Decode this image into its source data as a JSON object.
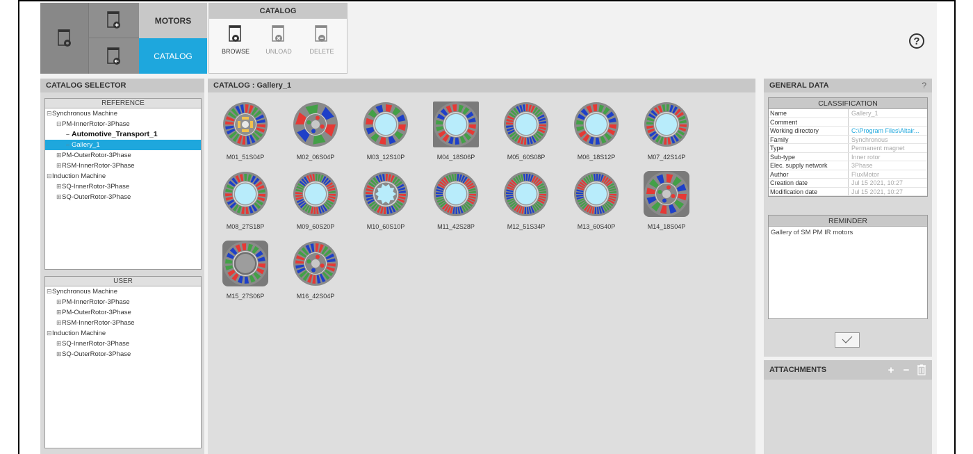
{
  "toolbar": {
    "motors_tab": "MOTORS",
    "catalog_tab": "CATALOG",
    "catalog_group_title": "CATALOG",
    "browse_label": "BROWSE",
    "unload_label": "UNLOAD",
    "delete_label": "DELETE",
    "help_glyph": "?"
  },
  "catalog_selector": {
    "title": "CATALOG SELECTOR",
    "reference": {
      "title": "REFERENCE",
      "nodes": [
        {
          "label": "Synchronous Machine",
          "sign": "⊟",
          "level": 0
        },
        {
          "label": "PM-InnerRotor-3Phase",
          "sign": "⊟",
          "level": 1
        },
        {
          "label": "Automotive_Transport_1",
          "sign": "",
          "level": 2,
          "bold": true
        },
        {
          "label": "Gallery_1",
          "sign": "",
          "level": 2,
          "selected": true
        },
        {
          "label": "PM-OuterRotor-3Phase",
          "sign": "⊞",
          "level": 1
        },
        {
          "label": "RSM-InnerRotor-3Phase",
          "sign": "⊞",
          "level": 1
        },
        {
          "label": "Induction Machine",
          "sign": "⊟",
          "level": 0
        },
        {
          "label": "SQ-InnerRotor-3Phase",
          "sign": "⊞",
          "level": 1
        },
        {
          "label": "SQ-OuterRotor-3Phase",
          "sign": "⊞",
          "level": 1
        }
      ]
    },
    "user": {
      "title": "USER",
      "nodes": [
        {
          "label": "Synchronous Machine",
          "sign": "⊟",
          "level": 0
        },
        {
          "label": "PM-InnerRotor-3Phase",
          "sign": "⊞",
          "level": 1
        },
        {
          "label": "PM-OuterRotor-3Phase",
          "sign": "⊞",
          "level": 1
        },
        {
          "label": "RSM-InnerRotor-3Phase",
          "sign": "⊞",
          "level": 1
        },
        {
          "label": "Induction Machine",
          "sign": "⊟",
          "level": 0
        },
        {
          "label": "SQ-InnerRotor-3Phase",
          "sign": "⊞",
          "level": 1
        },
        {
          "label": "SQ-OuterRotor-3Phase",
          "sign": "⊞",
          "level": 1
        }
      ]
    }
  },
  "catalog": {
    "title": "CATALOG : Gallery_1",
    "motors": [
      {
        "label": "M01_51S04P",
        "slots": 24,
        "rotor": "ipm",
        "square": false
      },
      {
        "label": "M02_06S04P",
        "slots": 6,
        "rotor": "spm",
        "square": false
      },
      {
        "label": "M03_12S10P",
        "slots": 12,
        "rotor": "ring",
        "square": false
      },
      {
        "label": "M04_18S06P",
        "slots": 18,
        "rotor": "ring",
        "square": true
      },
      {
        "label": "M05_60S08P",
        "slots": 36,
        "rotor": "ring",
        "square": false
      },
      {
        "label": "M06_18S12P",
        "slots": 18,
        "rotor": "ring",
        "square": false
      },
      {
        "label": "M07_42S14P",
        "slots": 28,
        "rotor": "ring",
        "square": false
      },
      {
        "label": "M08_27S18P",
        "slots": 27,
        "rotor": "ring",
        "square": false
      },
      {
        "label": "M09_60S20P",
        "slots": 40,
        "rotor": "ring",
        "square": false
      },
      {
        "label": "M10_60S10P",
        "slots": 36,
        "rotor": "star",
        "square": false
      },
      {
        "label": "M11_42S28P",
        "slots": 42,
        "rotor": "ring",
        "square": false
      },
      {
        "label": "M12_51S34P",
        "slots": 44,
        "rotor": "ring",
        "square": false
      },
      {
        "label": "M13_60S40P",
        "slots": 44,
        "rotor": "ring",
        "square": false
      },
      {
        "label": "M14_18S04P",
        "slots": 12,
        "rotor": "spm",
        "square": true
      },
      {
        "label": "M15_27S06P",
        "slots": 18,
        "rotor": "ring-gray",
        "square": true
      },
      {
        "label": "M16_42S04P",
        "slots": 24,
        "rotor": "spm",
        "square": false
      }
    ]
  },
  "general_data": {
    "title": "GENERAL DATA",
    "help": "?",
    "classification_title": "CLASSIFICATION",
    "rows": [
      {
        "key": "Name",
        "value": "Gallery_1"
      },
      {
        "key": "Comment",
        "value": ""
      },
      {
        "key": "Working directory",
        "value": "C:\\Program Files\\Altair...",
        "link": true
      },
      {
        "key": "Family",
        "value": "Synchronous"
      },
      {
        "key": "Type",
        "value": "Permanent magnet"
      },
      {
        "key": "Sub-type",
        "value": "Inner rotor"
      },
      {
        "key": "Elec. supply network",
        "value": "3Phase"
      },
      {
        "key": "Author",
        "value": "FluxMotor"
      },
      {
        "key": "Creation date",
        "value": "Jul 15 2021, 10:27"
      },
      {
        "key": "Modification date",
        "value": "Jul 15 2021, 10:27"
      }
    ],
    "reminder_title": "REMINDER",
    "reminder_text": "Gallery of SM PM IR motors"
  },
  "attachments": {
    "title": "ATTACHMENTS",
    "add": "+",
    "remove": "−",
    "trash": "🗑"
  },
  "colors": {
    "accent": "#1ea7dd",
    "header_gray": "#c8c8c8"
  }
}
